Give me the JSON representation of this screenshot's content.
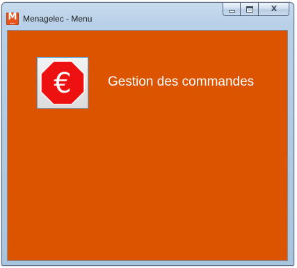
{
  "window": {
    "title": "Menagelec - Menu",
    "logo_letter": "M",
    "logo_sub": "elec",
    "close_glyph": "X"
  },
  "menu": {
    "items": [
      {
        "label": "Gestion des commandes",
        "icon": "euro-octagon-icon",
        "icon_symbol": "€"
      }
    ]
  },
  "colors": {
    "client_background": "#dd5400",
    "icon_red": "#ee1111",
    "text": "#ffffff"
  }
}
